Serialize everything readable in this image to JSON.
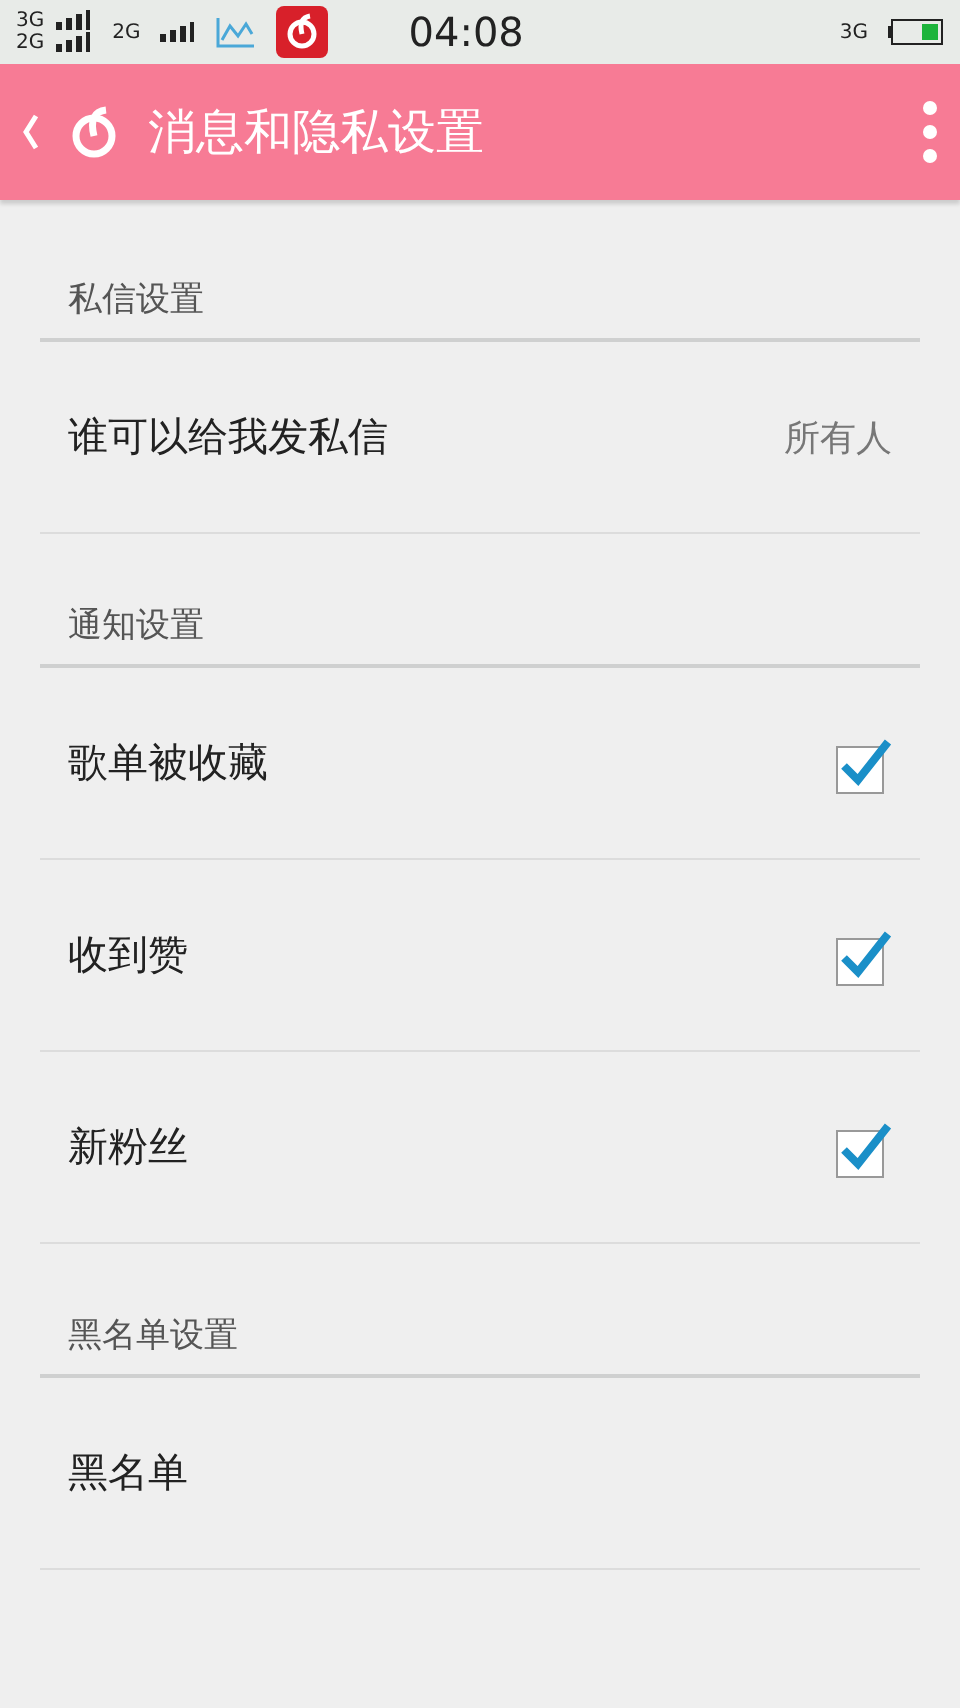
{
  "status_bar": {
    "sim1": "3G",
    "sim2": "2G",
    "sim3": "2G",
    "time": "04:08",
    "network": "3G"
  },
  "header": {
    "title": "消息和隐私设置"
  },
  "sections": [
    {
      "title": "私信设置",
      "rows": [
        {
          "kind": "value",
          "label": "谁可以给我发私信",
          "value": "所有人"
        }
      ]
    },
    {
      "title": "通知设置",
      "rows": [
        {
          "kind": "checkbox",
          "label": "歌单被收藏",
          "checked": true
        },
        {
          "kind": "checkbox",
          "label": "收到赞",
          "checked": true
        },
        {
          "kind": "checkbox",
          "label": "新粉丝",
          "checked": true
        }
      ]
    },
    {
      "title": "黑名单设置",
      "rows": [
        {
          "kind": "link",
          "label": "黑名单"
        }
      ]
    }
  ]
}
